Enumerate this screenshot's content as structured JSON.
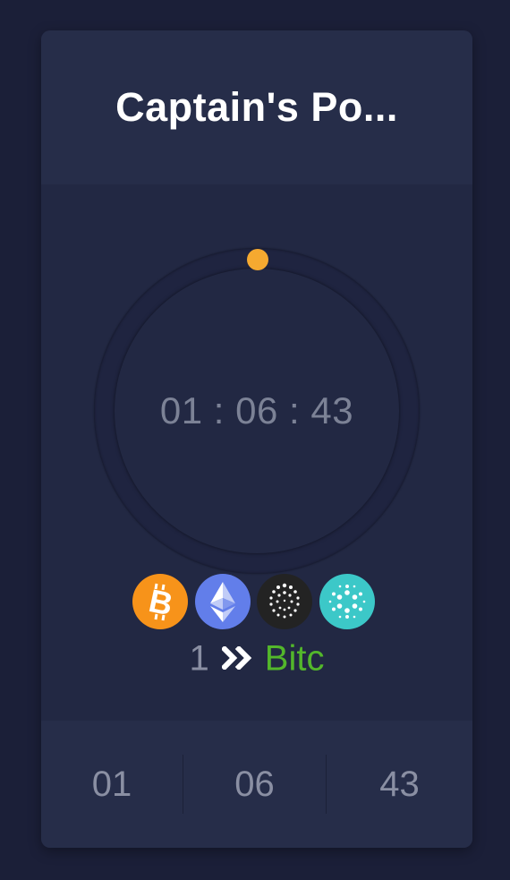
{
  "header": {
    "title": "Captain's Po..."
  },
  "timer": {
    "display": "01 : 06 : 43",
    "progress_indicator_color": "#f5a930"
  },
  "coins": [
    {
      "name": "bitcoin",
      "icon": "bitcoin-icon",
      "color": "#f7931a"
    },
    {
      "name": "ethereum",
      "icon": "ethereum-icon",
      "color": "#627eea"
    },
    {
      "name": "iota",
      "icon": "iota-icon",
      "color": "#232323"
    },
    {
      "name": "cardano",
      "icon": "cardano-icon",
      "color": "#3cc8c8"
    }
  ],
  "pair": {
    "count": "1",
    "arrow_icon": "double-chevron-right-icon",
    "name": "Bitc",
    "name_color": "#53b72b"
  },
  "footer": {
    "hours": "01",
    "minutes": "06",
    "seconds": "43"
  }
}
